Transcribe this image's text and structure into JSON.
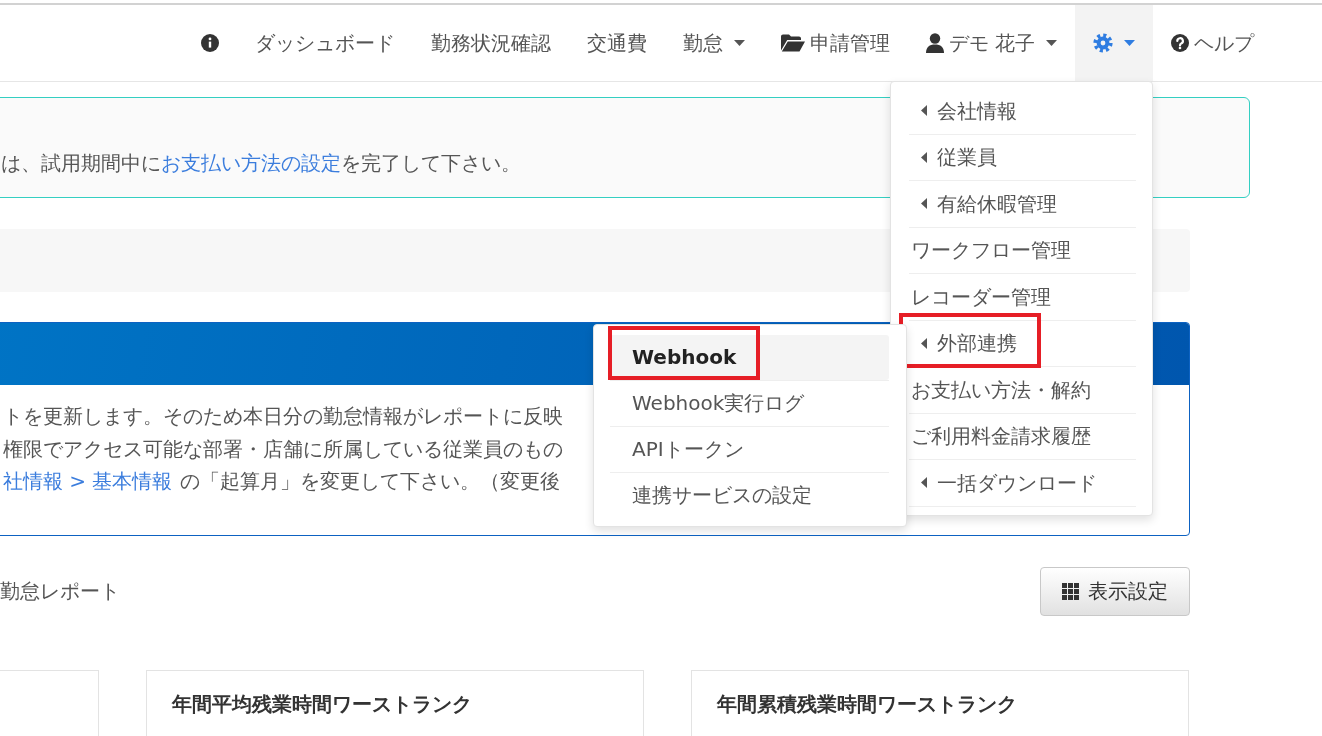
{
  "navbar": {
    "items": [
      {
        "kind": "info",
        "dropdown": false,
        "selected": false
      },
      {
        "kind": "link",
        "label": "ダッシュボード",
        "dropdown": false,
        "selected": false
      },
      {
        "kind": "link",
        "label": "勤務状況確認",
        "dropdown": false,
        "selected": false
      },
      {
        "kind": "link",
        "label": "交通費",
        "dropdown": false,
        "selected": false
      },
      {
        "kind": "link",
        "label": "勤怠",
        "dropdown": true,
        "selected": false
      },
      {
        "kind": "applications",
        "label": "申請管理",
        "dropdown": false,
        "selected": false
      },
      {
        "kind": "user",
        "label": "デモ 花子",
        "dropdown": true,
        "selected": false
      },
      {
        "kind": "settings",
        "dropdown": true,
        "selected": true,
        "menu": [
          {
            "kind": "submenu",
            "label": "会社情報",
            "highlighted": false
          },
          {
            "kind": "submenu",
            "label": "従業員",
            "highlighted": false
          },
          {
            "kind": "submenu",
            "label": "有給休暇管理",
            "highlighted": false
          },
          {
            "kind": "link",
            "label": "ワークフロー管理",
            "highlighted": false
          },
          {
            "kind": "link",
            "label": "レコーダー管理",
            "highlighted": false
          },
          {
            "kind": "submenu",
            "label": "外部連携",
            "highlighted": true,
            "children": [
              {
                "label": "Webhook",
                "selected": true,
                "highlighted": true
              },
              {
                "label": "Webhook実行ログ",
                "selected": false,
                "highlighted": false
              },
              {
                "label": "APIトークン",
                "selected": false,
                "highlighted": false
              },
              {
                "label": "連携サービスの設定",
                "selected": false,
                "highlighted": false
              }
            ]
          },
          {
            "kind": "link",
            "label": "お支払い方法・解約",
            "highlighted": false
          },
          {
            "kind": "link",
            "label": "ご利用料金請求履歴",
            "highlighted": false
          },
          {
            "kind": "submenu",
            "label": "一括ダウンロード",
            "highlighted": false
          }
        ]
      },
      {
        "kind": "help",
        "label": "ヘルプ",
        "dropdown": false,
        "selected": false
      }
    ]
  },
  "trial_notice": {
    "before": "は、試用期間中に",
    "link": "お支払い方法の設定",
    "after": "を完了して下さい。"
  },
  "report_notice": {
    "lines": [
      {
        "text": "トを更新します。そのため本日分の勤怠情報がレポートに反映"
      },
      {
        "text": "権限でアクセス可能な部署・店舗に所属している従業員のもの"
      },
      {
        "link": "社情報 > 基本情報",
        "text": "の「起算月」を変更して下さい。（変更後"
      }
    ]
  },
  "report_section": {
    "title": "勤怠レポート",
    "settings_button": "表示設定",
    "cards": [
      {
        "title": "年間平均残業時間ワーストランク"
      },
      {
        "title": "年間累積残業時間ワーストランク"
      }
    ]
  }
}
